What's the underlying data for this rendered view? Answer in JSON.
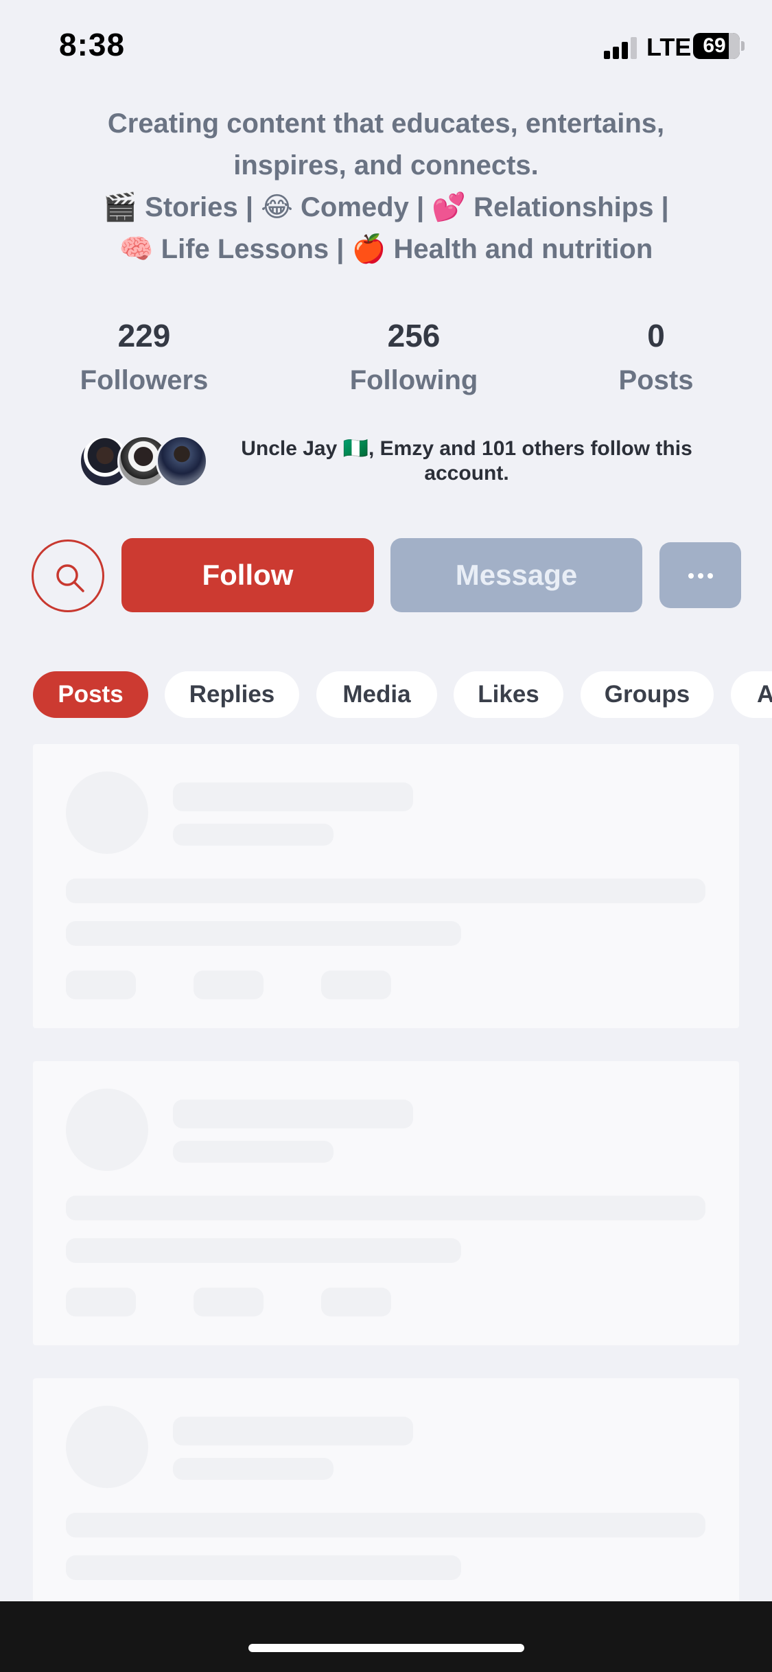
{
  "status_bar": {
    "time": "8:38",
    "network": "LTE",
    "battery": "69"
  },
  "bio": {
    "lines": [
      "Creating content that educates, entertains,",
      "inspires, and connects.",
      "🎬 Stories | 😂 Comedy | 💕 Relationships |",
      "🧠 Life Lessons | 🍎 Health and nutrition"
    ]
  },
  "stats": [
    {
      "value": "229",
      "label": "Followers"
    },
    {
      "value": "256",
      "label": "Following"
    },
    {
      "value": "0",
      "label": "Posts"
    }
  ],
  "mutual": {
    "text": "Uncle Jay 🇳🇬, Emzy and 101 others follow this account."
  },
  "actions": {
    "follow_label": "Follow",
    "message_label": "Message"
  },
  "tabs": [
    {
      "label": "Posts",
      "active": true
    },
    {
      "label": "Replies",
      "active": false
    },
    {
      "label": "Media",
      "active": false
    },
    {
      "label": "Likes",
      "active": false
    },
    {
      "label": "Groups",
      "active": false
    },
    {
      "label": "A",
      "active": false
    }
  ],
  "icons": {
    "search": "search-icon",
    "more": "more-horizontal-icon",
    "signal": "signal-icon",
    "battery": "battery-icon"
  },
  "colors": {
    "accent": "#cc3a31",
    "muted_button": "#a2b0c7",
    "background": "#f0f1f6"
  }
}
